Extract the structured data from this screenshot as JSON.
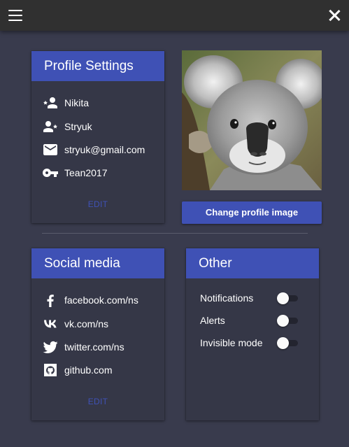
{
  "theme": {
    "accent": "#3f51b5",
    "background": "#393b4d",
    "card": "#353747",
    "topbar": "#303030"
  },
  "topbar": {
    "menu_icon": "hamburger-menu-icon",
    "close_icon": "close-icon"
  },
  "profile_settings": {
    "title": "Profile Settings",
    "items": [
      {
        "icon": "person-star-icon",
        "value": "Nikita"
      },
      {
        "icon": "person-star-icon",
        "value": "Stryuk"
      },
      {
        "icon": "email-icon",
        "value": "stryuk@gmail.com"
      },
      {
        "icon": "key-icon",
        "value": "Tean2017"
      }
    ],
    "edit_label": "EDIT"
  },
  "profile_image": {
    "change_label": "Change profile image"
  },
  "social_media": {
    "title": "Social media",
    "items": [
      {
        "icon": "facebook-icon",
        "value": "facebook.com/ns"
      },
      {
        "icon": "vk-icon",
        "value": "vk.com/ns"
      },
      {
        "icon": "twitter-icon",
        "value": "twitter.com/ns"
      },
      {
        "icon": "github-icon",
        "value": "github.com"
      }
    ],
    "edit_label": "EDIT"
  },
  "other": {
    "title": "Other",
    "toggles": [
      {
        "label": "Notifications",
        "on": false
      },
      {
        "label": "Alerts",
        "on": false
      },
      {
        "label": "Invisible mode",
        "on": false
      }
    ]
  }
}
